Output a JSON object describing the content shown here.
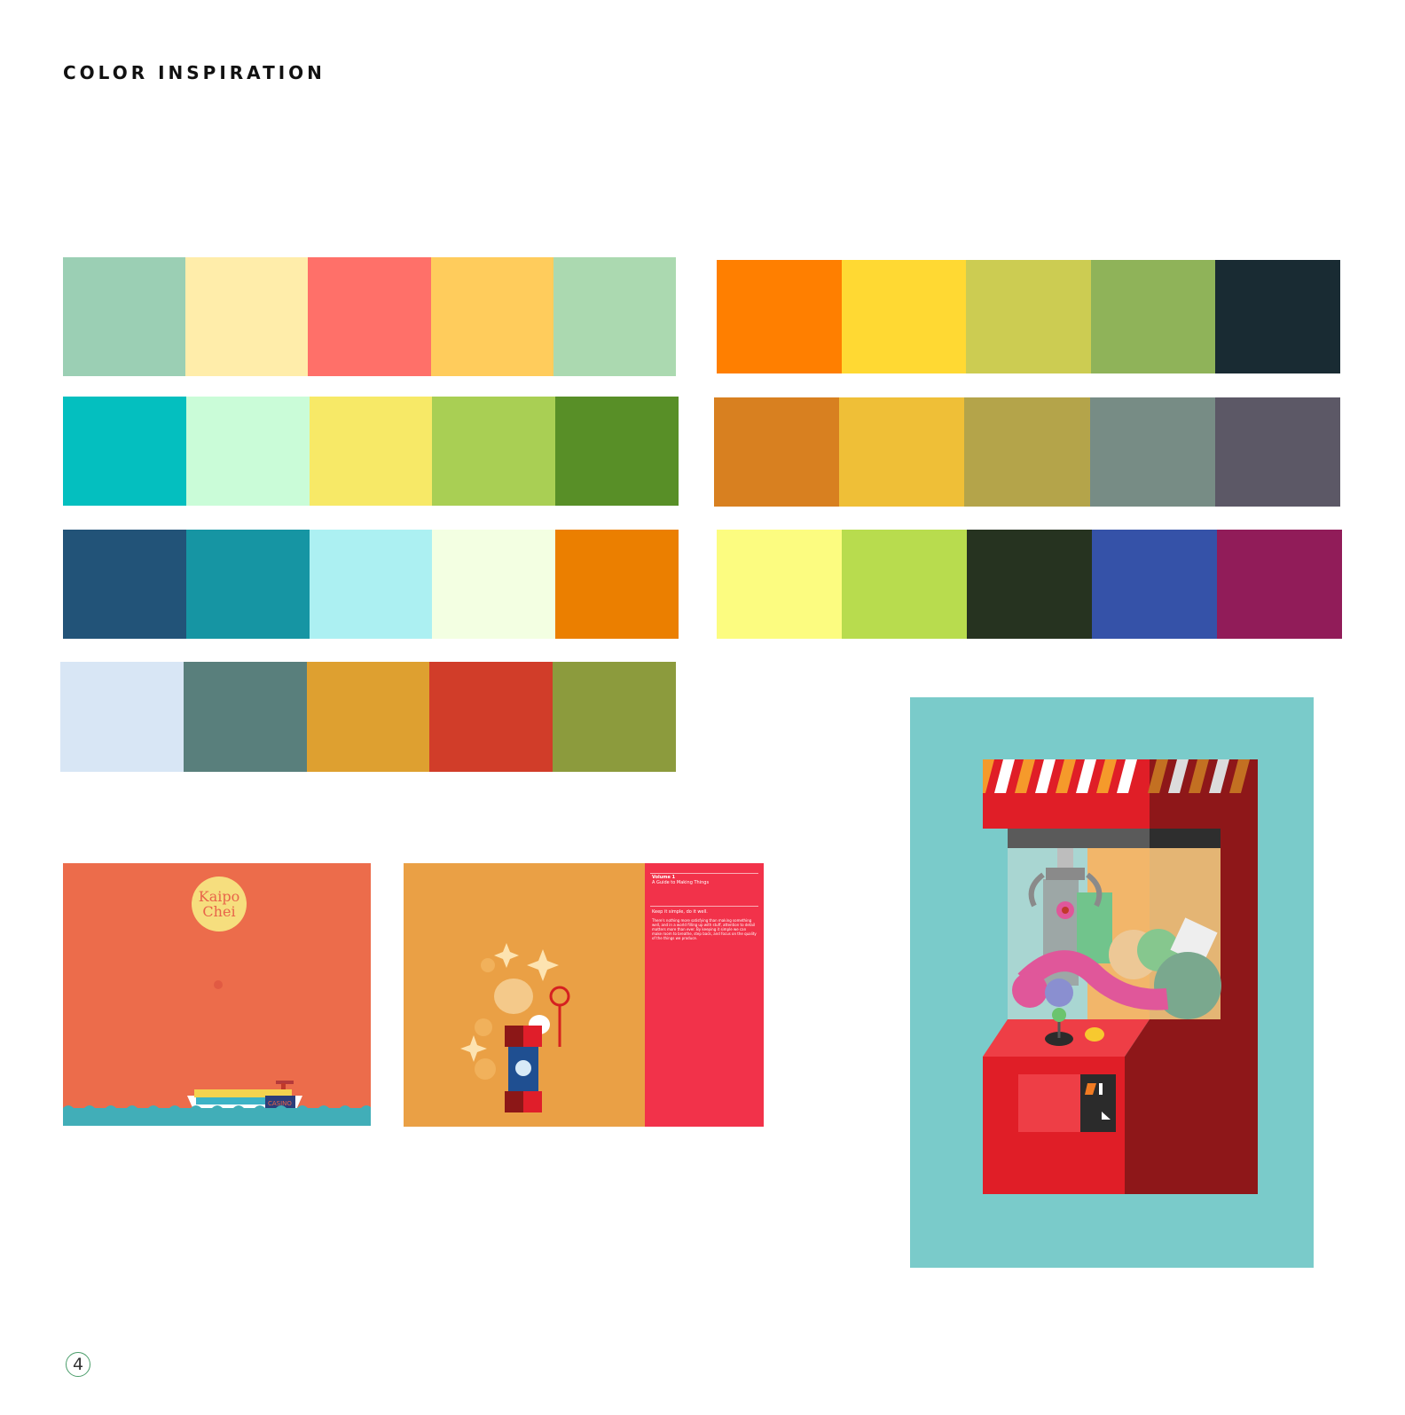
{
  "page": {
    "title": "COLOR INSPIRATION",
    "page_number": "4"
  },
  "palettes": [
    {
      "colors": [
        "#9bcfb4",
        "#ffedaa",
        "#ff7069",
        "#ffcc5c",
        "#abd9b0"
      ]
    },
    {
      "colors": [
        "#ff7f00",
        "#ffd933",
        "#cccc52",
        "#8fb359",
        "#192b33"
      ]
    },
    {
      "colors": [
        "#04bfbf",
        "#cafcd8",
        "#f7e967",
        "#a9cf54",
        "#588f27"
      ]
    },
    {
      "colors": [
        "#d88020",
        "#efbf37",
        "#b4a44a",
        "#778c85",
        "#5c5866"
      ]
    },
    {
      "colors": [
        "#225378",
        "#1695a3",
        "#acf0f2",
        "#f3ffe2",
        "#eb7f00"
      ]
    },
    {
      "colors": [
        "#fcfc80",
        "#b8dc4e",
        "#263320",
        "#3552a8",
        "#911c59"
      ]
    },
    {
      "colors": [
        "#d8e6f5",
        "#597f7c",
        "#dea030",
        "#d13d29",
        "#8c9b3d"
      ]
    }
  ],
  "images": {
    "kaipo": {
      "logo_line1": "Kaipo",
      "logo_line2": "Chei",
      "ship_label": "CASINO"
    },
    "book": {
      "volume": "Volume 1",
      "subtitle": "A Guide to Making Things",
      "heading": "Keep it simple, do it well.",
      "body": "There's nothing more satisfying than making something well, and in a world filling up with stuff, attention to detail matters more than ever. By keeping it simple we can make room to breathe, step back, and focus on the quality of the things we produce."
    },
    "claw_machine": {}
  }
}
